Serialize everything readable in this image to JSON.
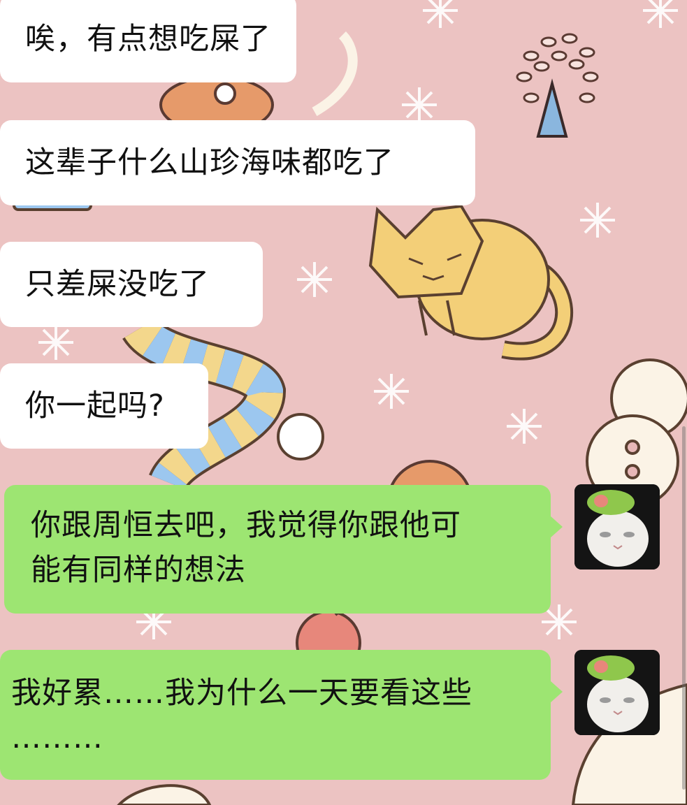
{
  "chat": {
    "messages": [
      {
        "side": "left",
        "text": "唉，有点想吃屎了"
      },
      {
        "side": "left",
        "text": "这辈子什么山珍海味都吃了"
      },
      {
        "side": "left",
        "text": "只差屎没吃了"
      },
      {
        "side": "left",
        "text": "你一起吗?"
      },
      {
        "side": "right",
        "lines": [
          "你跟周恒去吧，我觉得你跟他可",
          "能有同样的想法"
        ],
        "avatar": "cat-avatar-icon"
      },
      {
        "side": "right",
        "lines": [
          "我好累……我为什么一天要看这些",
          "………"
        ],
        "avatar": "cat-avatar-icon"
      }
    ]
  },
  "colors": {
    "background": "#ecc3c2",
    "incoming_bubble": "#ffffff",
    "outgoing_bubble": "#9de572"
  }
}
